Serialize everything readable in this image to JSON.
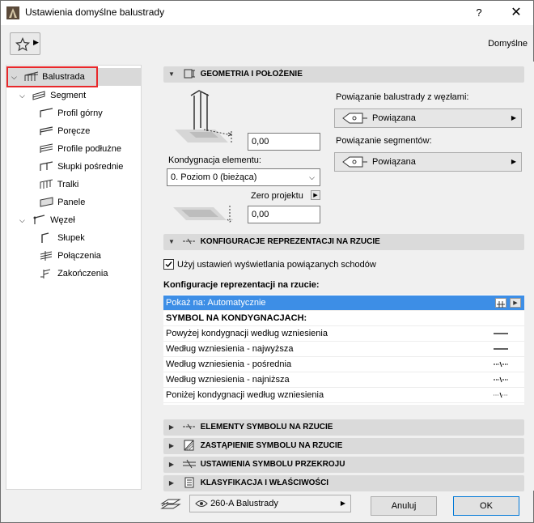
{
  "window": {
    "title": "Ustawienia domyślne balustrady",
    "help": "?",
    "close": "✕"
  },
  "toolbar": {
    "favorites_icon": "star-icon",
    "default_label": "Domyślne"
  },
  "tree": {
    "items": [
      {
        "label": "Balustrada",
        "level": 0,
        "expanded": true,
        "selected": true
      },
      {
        "label": "Segment",
        "level": 1,
        "expanded": true
      },
      {
        "label": "Profil górny",
        "level": 2
      },
      {
        "label": "Poręcze",
        "level": 2
      },
      {
        "label": "Profile podłużne",
        "level": 2
      },
      {
        "label": "Słupki pośrednie",
        "level": 2
      },
      {
        "label": "Tralki",
        "level": 2
      },
      {
        "label": "Panele",
        "level": 2
      },
      {
        "label": "Węzeł",
        "level": 1,
        "expanded": true
      },
      {
        "label": "Słupek",
        "level": 2
      },
      {
        "label": "Połączenia",
        "level": 2
      },
      {
        "label": "Zakończenia",
        "level": 2
      }
    ]
  },
  "geometry": {
    "header": "GEOMETRIA I POŁOŻENIE",
    "height_value": "0,00",
    "story_label": "Kondygnacja elementu:",
    "story_value": "0. Poziom 0 (bieżąca)",
    "zero_label": "Zero projektu",
    "offset_value": "0,00",
    "node_link_label": "Powiązanie balustrady z węzłami:",
    "node_link_value": "Powiązana",
    "segment_link_label": "Powiązanie segmentów:",
    "segment_link_value": "Powiązana"
  },
  "floorplan": {
    "header": "KONFIGURACJE REPREZENTACJI NA RZUCIE",
    "checkbox_label": "Użyj ustawień wyświetlania powiązanych schodów",
    "checkbox_checked": true,
    "config_label": "Konfiguracje reprezentacji na rzucie:",
    "show_on": "Pokaż na: Automatycznie",
    "symbol_header": "SYMBOL NA KONDYGNACJACH:",
    "rows": [
      {
        "label": "Powyżej kondygnacji według wzniesienia",
        "symbol": "solid"
      },
      {
        "label": "Według wzniesienia - najwyższa",
        "symbol": "solid"
      },
      {
        "label": "Według wzniesienia - pośrednia",
        "symbol": "break"
      },
      {
        "label": "Według wzniesienia - najniższa",
        "symbol": "break"
      },
      {
        "label": "Poniżej kondygnacji według wzniesienia",
        "symbol": "dashbreak"
      }
    ]
  },
  "collapsed_sections": [
    {
      "label": "ELEMENTY SYMBOLU NA RZUCIE",
      "icon": "symbol-icon"
    },
    {
      "label": "ZASTĄPIENIE SYMBOLU NA RZUCIE",
      "icon": "override-icon"
    },
    {
      "label": "USTAWIENIA SYMBOLU PRZEKROJU",
      "icon": "section-icon"
    },
    {
      "label": "KLASYFIKACJA I WŁAŚCIWOŚCI",
      "icon": "classification-icon"
    }
  ],
  "footer": {
    "layer_value": "260-A Balustrady",
    "cancel": "Anuluj",
    "ok": "OK"
  },
  "colors": {
    "selection": "#3d8ee6",
    "highlight_box": "#e8282b",
    "section_header": "#dadada"
  }
}
